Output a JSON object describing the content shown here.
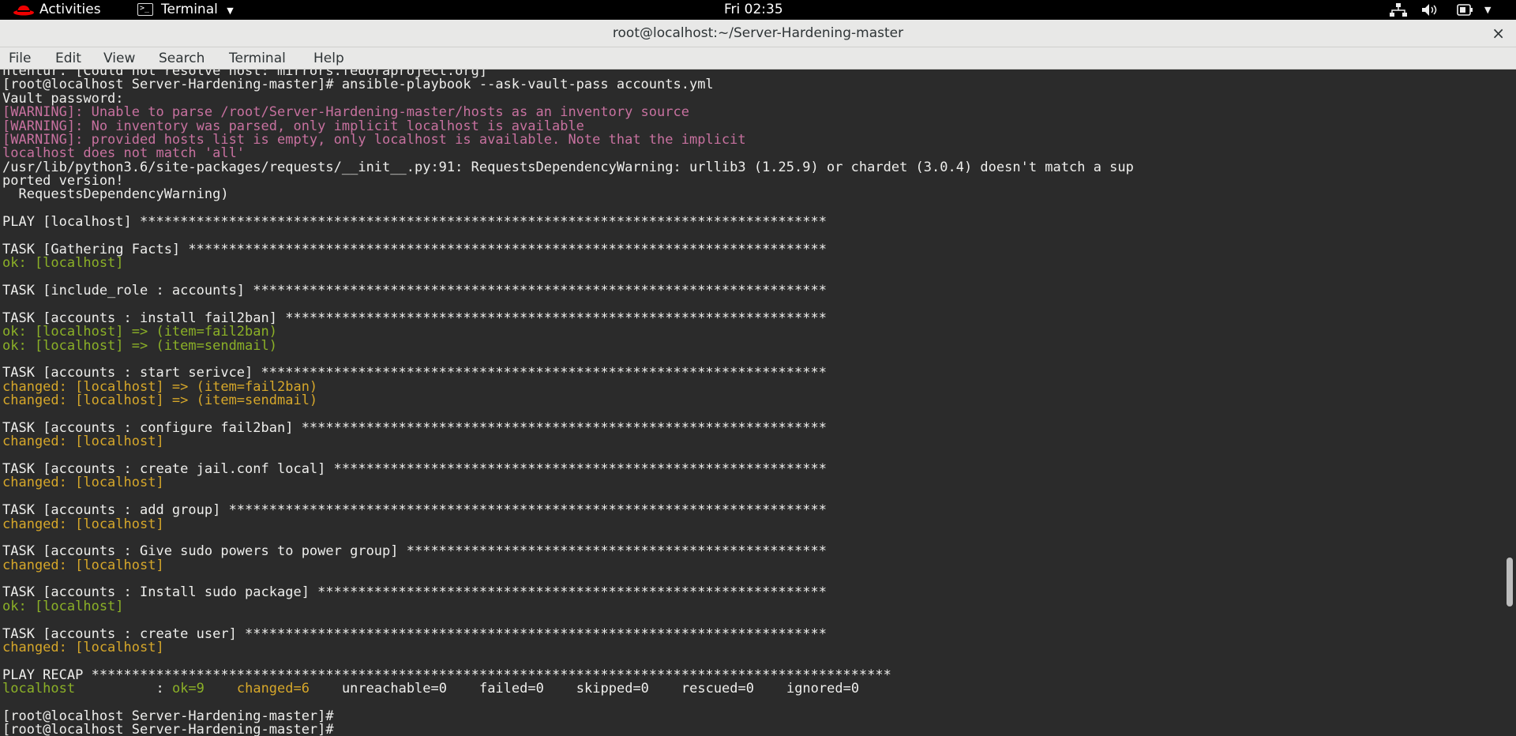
{
  "topbar": {
    "activities": "Activities",
    "app_menu": "Terminal",
    "clock": "Fri 02:35"
  },
  "window": {
    "title": "root@localhost:~/Server-Hardening-master",
    "close": "×"
  },
  "menubar": [
    "File",
    "Edit",
    "View",
    "Search",
    "Terminal",
    "Help"
  ],
  "terminal": {
    "lines": [
      {
        "text": "ntentur. [Could not resolve host: mirrors.fedoraproject.org]",
        "color": "w"
      },
      {
        "text": "[root@localhost Server-Hardening-master]# ansible-playbook --ask-vault-pass accounts.yml",
        "color": "w"
      },
      {
        "text": "Vault password:",
        "color": "w"
      },
      {
        "text": "[WARNING]: Unable to parse /root/Server-Hardening-master/hosts as an inventory source",
        "color": "p"
      },
      {
        "text": "[WARNING]: No inventory was parsed, only implicit localhost is available",
        "color": "p"
      },
      {
        "text": "[WARNING]: provided hosts list is empty, only localhost is available. Note that the implicit",
        "color": "p"
      },
      {
        "text": "localhost does not match 'all'",
        "color": "p"
      },
      {
        "text": "/usr/lib/python3.6/site-packages/requests/__init__.py:91: RequestsDependencyWarning: urllib3 (1.25.9) or chardet (3.0.4) doesn't match a sup",
        "color": "w"
      },
      {
        "text": "ported version!",
        "color": "w"
      },
      {
        "text": "  RequestsDependencyWarning)",
        "color": "w"
      },
      {
        "text": "",
        "color": "w"
      },
      {
        "text": "PLAY [localhost] *************************************************************************************",
        "color": "w"
      },
      {
        "text": "",
        "color": "w"
      },
      {
        "text": "TASK [Gathering Facts] *******************************************************************************",
        "color": "w"
      },
      {
        "text": "ok: [localhost]",
        "color": "g"
      },
      {
        "text": "",
        "color": "w"
      },
      {
        "text": "TASK [include_role : accounts] ***********************************************************************",
        "color": "w"
      },
      {
        "text": "",
        "color": "w"
      },
      {
        "text": "TASK [accounts : install fail2ban] *******************************************************************",
        "color": "w"
      },
      {
        "text": "ok: [localhost] => (item=fail2ban)",
        "color": "g"
      },
      {
        "text": "ok: [localhost] => (item=sendmail)",
        "color": "g"
      },
      {
        "text": "",
        "color": "w"
      },
      {
        "text": "TASK [accounts : start serivce] **********************************************************************",
        "color": "w"
      },
      {
        "text": "changed: [localhost] => (item=fail2ban)",
        "color": "y"
      },
      {
        "text": "changed: [localhost] => (item=sendmail)",
        "color": "y"
      },
      {
        "text": "",
        "color": "w"
      },
      {
        "text": "TASK [accounts : configure fail2ban] *****************************************************************",
        "color": "w"
      },
      {
        "text": "changed: [localhost]",
        "color": "y"
      },
      {
        "text": "",
        "color": "w"
      },
      {
        "text": "TASK [accounts : create jail.conf local] *************************************************************",
        "color": "w"
      },
      {
        "text": "changed: [localhost]",
        "color": "y"
      },
      {
        "text": "",
        "color": "w"
      },
      {
        "text": "TASK [accounts : add group] **************************************************************************",
        "color": "w"
      },
      {
        "text": "changed: [localhost]",
        "color": "y"
      },
      {
        "text": "",
        "color": "w"
      },
      {
        "text": "TASK [accounts : Give sudo powers to power group] ****************************************************",
        "color": "w"
      },
      {
        "text": "changed: [localhost]",
        "color": "y"
      },
      {
        "text": "",
        "color": "w"
      },
      {
        "text": "TASK [accounts : Install sudo package] ***************************************************************",
        "color": "w"
      },
      {
        "text": "ok: [localhost]",
        "color": "g"
      },
      {
        "text": "",
        "color": "w"
      },
      {
        "text": "TASK [accounts : create user] ************************************************************************",
        "color": "w"
      },
      {
        "text": "changed: [localhost]",
        "color": "y"
      },
      {
        "text": "",
        "color": "w"
      },
      {
        "text": "PLAY RECAP ***************************************************************************************************",
        "color": "w"
      },
      {
        "recap": true,
        "host": "localhost",
        "colon": "          : ",
        "ok": "ok=9",
        "changed": "changed=6",
        "unreachable": "unreachable=0",
        "failed": "failed=0",
        "skipped": "skipped=0",
        "rescued": "rescued=0",
        "ignored": "ignored=0"
      },
      {
        "text": "",
        "color": "w"
      },
      {
        "text": "[root@localhost Server-Hardening-master]#",
        "color": "w"
      },
      {
        "text": "[root@localhost Server-Hardening-master]#",
        "color": "w"
      }
    ]
  }
}
